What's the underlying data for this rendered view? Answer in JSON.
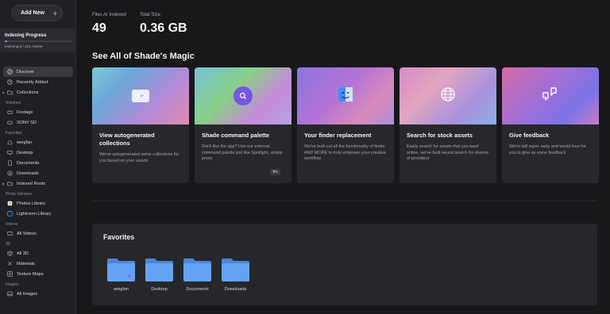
{
  "sidebar": {
    "add_new_label": "Add New",
    "indexing": {
      "title": "Indexing Progress",
      "status": "Indexing 8 / 221 Assets",
      "progress_fraction": 0.036
    },
    "top_items": [
      {
        "label": "Discover",
        "icon": "compass-icon"
      },
      {
        "label": "Recently Added",
        "icon": "clock-icon"
      },
      {
        "label": "Collections",
        "icon": "folder-icon"
      }
    ],
    "sections": [
      {
        "title": "Volumes",
        "items": [
          {
            "label": "Footage"
          },
          {
            "label": "SONY SD"
          }
        ]
      },
      {
        "title": "Favorites",
        "items": [
          {
            "label": "weigfan"
          },
          {
            "label": "Desktop"
          },
          {
            "label": "Documents"
          },
          {
            "label": "Downloads"
          },
          {
            "label": "Indexed Roots"
          }
        ]
      },
      {
        "title": "Photo Libraries",
        "items": [
          {
            "label": "Photos Library"
          },
          {
            "label": "Lightroom Library"
          }
        ]
      },
      {
        "title": "Videos",
        "items": [
          {
            "label": "All Videos"
          }
        ]
      },
      {
        "title": "3D",
        "items": [
          {
            "label": "All 3D"
          },
          {
            "label": "Materials"
          },
          {
            "label": "Texture Maps"
          }
        ]
      },
      {
        "title": "Images",
        "items": [
          {
            "label": "All Images"
          }
        ]
      }
    ]
  },
  "stats": {
    "files_label": "Files AI Indexed",
    "files_value": "49",
    "size_label": "Total Size",
    "size_value": "0.36 GB"
  },
  "magic": {
    "title": "See All of Shade's Magic",
    "cards": [
      {
        "title": "View autogenerated collections",
        "desc": "We've autogenerated some collections for you based on your assets",
        "icon": "folder-sparkle-icon"
      },
      {
        "title": "Shade command palette",
        "desc": "Don't like the app? Use our external command palette just like Spotlight, simply press",
        "shortcut": "⌘K",
        "icon": "search-icon"
      },
      {
        "title": "Your finder replacement",
        "desc": "We've built out all the functionality of finder AND MORE to truly empower your creative workflow",
        "icon": "finder-icon"
      },
      {
        "title": "Search for stock assets",
        "desc": "Easily search for assets that you want online, we've built neural search for dozens of providers",
        "icon": "globe-icon"
      },
      {
        "title": "Give feedback",
        "desc": "We're still super early and would love for you to give us some feedback",
        "icon": "chat-bubbles-icon"
      }
    ]
  },
  "favorites": {
    "title": "Favorites",
    "folders": [
      {
        "label": "weigfan"
      },
      {
        "label": "Desktop"
      },
      {
        "label": "Documents"
      },
      {
        "label": "Downloads"
      }
    ]
  },
  "colors": {
    "accent": "#7557e0",
    "background": "#18181b",
    "sidebar": "#1f2023",
    "card": "#27282c",
    "folder": "#5f9ff2"
  }
}
